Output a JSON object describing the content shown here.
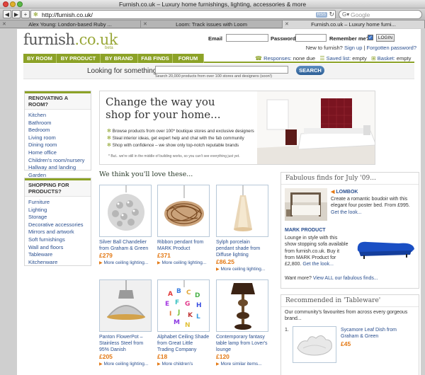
{
  "browser": {
    "window_title": "Furnish.co.uk – Luxury home furnishings, lighting, accessories & more",
    "url": "http://furnish.co.uk/",
    "search_placeholder": "Google",
    "rss": "RSS",
    "tabs": [
      "Alex Young: London-based Ruby ...",
      "Loom: Track issues with Loom",
      "Furnish.co.uk – Luxury home furni..."
    ]
  },
  "site": {
    "logo": "furnish",
    "logo_tld": ".co.uk",
    "logo_beta": "beta"
  },
  "login": {
    "email_label": "Email",
    "password_label": "Password",
    "remember_label": "Remember me?",
    "login_button": "LOGIN",
    "new_prefix": "New to furnish?",
    "signup": "Sign up",
    "separator": "|",
    "forgotten": "Forgotten password?"
  },
  "nav": {
    "items": [
      "BY ROOM",
      "BY PRODUCT",
      "BY BRAND",
      "FAB FINDS",
      "FORUM"
    ],
    "responses_label": "Responses:",
    "responses_value": "none due",
    "saved_label": "Saved list:",
    "saved_value": "empty",
    "basket_label": "Basket:",
    "basket_value": "empty"
  },
  "search": {
    "label": "Looking for something?",
    "hint": "Search 20,000 products from over 100 stores and designers (soon!)",
    "button": "SEARCH"
  },
  "sidebar": {
    "renovating_title": "RENOVATING A ROOM?",
    "rooms": [
      "Kitchen",
      "Bathroom",
      "Bedroom",
      "Living room",
      "Dining room",
      "Home office",
      "Children's room/nursery",
      "Hallway and landing",
      "Garden"
    ],
    "shopping_title_1": "SHOPPING FOR",
    "shopping_title_2": "PRODUCTS?",
    "products": [
      "Furniture",
      "Lighting",
      "Storage",
      "Decorative accessories",
      "Mirrors and artwork",
      "Soft furnishings",
      "Wall and floors",
      "Tableware",
      "Kitchenware"
    ]
  },
  "hero": {
    "title_1": "Change the way you",
    "title_2": "shop for your home...",
    "bullets": [
      "Browse products from over 100* boutique stores and exclusive designers",
      "Steal interior ideas, get expert help and chat with the fab community",
      "Shop with confidence – we show only top-notch reputable brands"
    ],
    "footnote": "* But.. we're still in the middle of building works, so you can't see everything just yet."
  },
  "love": {
    "title": "We think you'll love these...",
    "products": [
      {
        "name": "Silver Ball Chandelier from Graham & Green",
        "price": "£279",
        "more": "More ceiling lighting..."
      },
      {
        "name": "Ribbon pendant from MARK Product",
        "price": "£371",
        "more": "More ceiling lighting..."
      },
      {
        "name": "Sylph porcelain pendant shade from Diffuse lighting",
        "price": "£86.25",
        "more": "More ceiling lighting..."
      },
      {
        "name": "Panton FlowerPot – Stainless Steel from 95% Danish",
        "price": "£205",
        "more": "More ceiling lighting..."
      },
      {
        "name": "Alphabet Ceiling Shade from Great Little Trading Company",
        "price": "£18",
        "more": "More children's"
      },
      {
        "name": "Contemporary fantasy table lamp from Lover's lounge",
        "price": "£120",
        "more": "More similar items..."
      }
    ]
  },
  "fab": {
    "title": "Fabulous finds for July '09...",
    "items": [
      {
        "tag": "LOMBOK",
        "text": "Create a romantic boudoir with this elegant four poster bed. From £995.",
        "link": "Get the look..."
      },
      {
        "tag": "MARK PRODUCT",
        "text": "Lounge in style with this show stopping sofa available from furnish.co.uk. Buy it from MARK Product for £2,800.",
        "link": "Get the look..."
      }
    ],
    "footer_prefix": "Want more?",
    "footer_link": "View ALL our fabulous finds..."
  },
  "recommended": {
    "title": "Recommended in 'Tableware'",
    "intro": "Our community's favourites from across every gorgeous brand...",
    "items": [
      {
        "num": "1.",
        "name": "Sycamore Leaf Dish from Graham & Green",
        "price": "£45"
      }
    ]
  }
}
